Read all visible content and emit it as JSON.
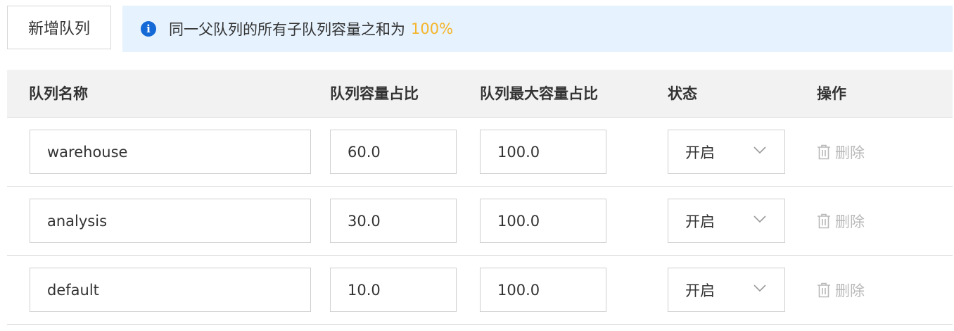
{
  "toolbar": {
    "add_label": "新增队列"
  },
  "notice": {
    "text": "同一父队列的所有子队列容量之和为",
    "highlight": "100%",
    "highlight_color": "#f5b52b",
    "icon": "info-icon"
  },
  "table": {
    "headers": {
      "name": "队列名称",
      "capacity": "队列容量占比",
      "max_capacity": "队列最大容量占比",
      "status": "状态",
      "actions": "操作"
    },
    "rows": [
      {
        "name": "warehouse",
        "capacity": "60.0",
        "max_capacity": "100.0",
        "status": "开启",
        "delete_label": "删除"
      },
      {
        "name": "analysis",
        "capacity": "30.0",
        "max_capacity": "100.0",
        "status": "开启",
        "delete_label": "删除"
      },
      {
        "name": "default",
        "capacity": "10.0",
        "max_capacity": "100.0",
        "status": "开启",
        "delete_label": "删除"
      }
    ]
  },
  "colors": {
    "info_blue": "#1569d6",
    "notice_bg": "#e6f2fd",
    "header_bg": "#f2f2f2",
    "disabled_text": "#b8b8b8"
  }
}
